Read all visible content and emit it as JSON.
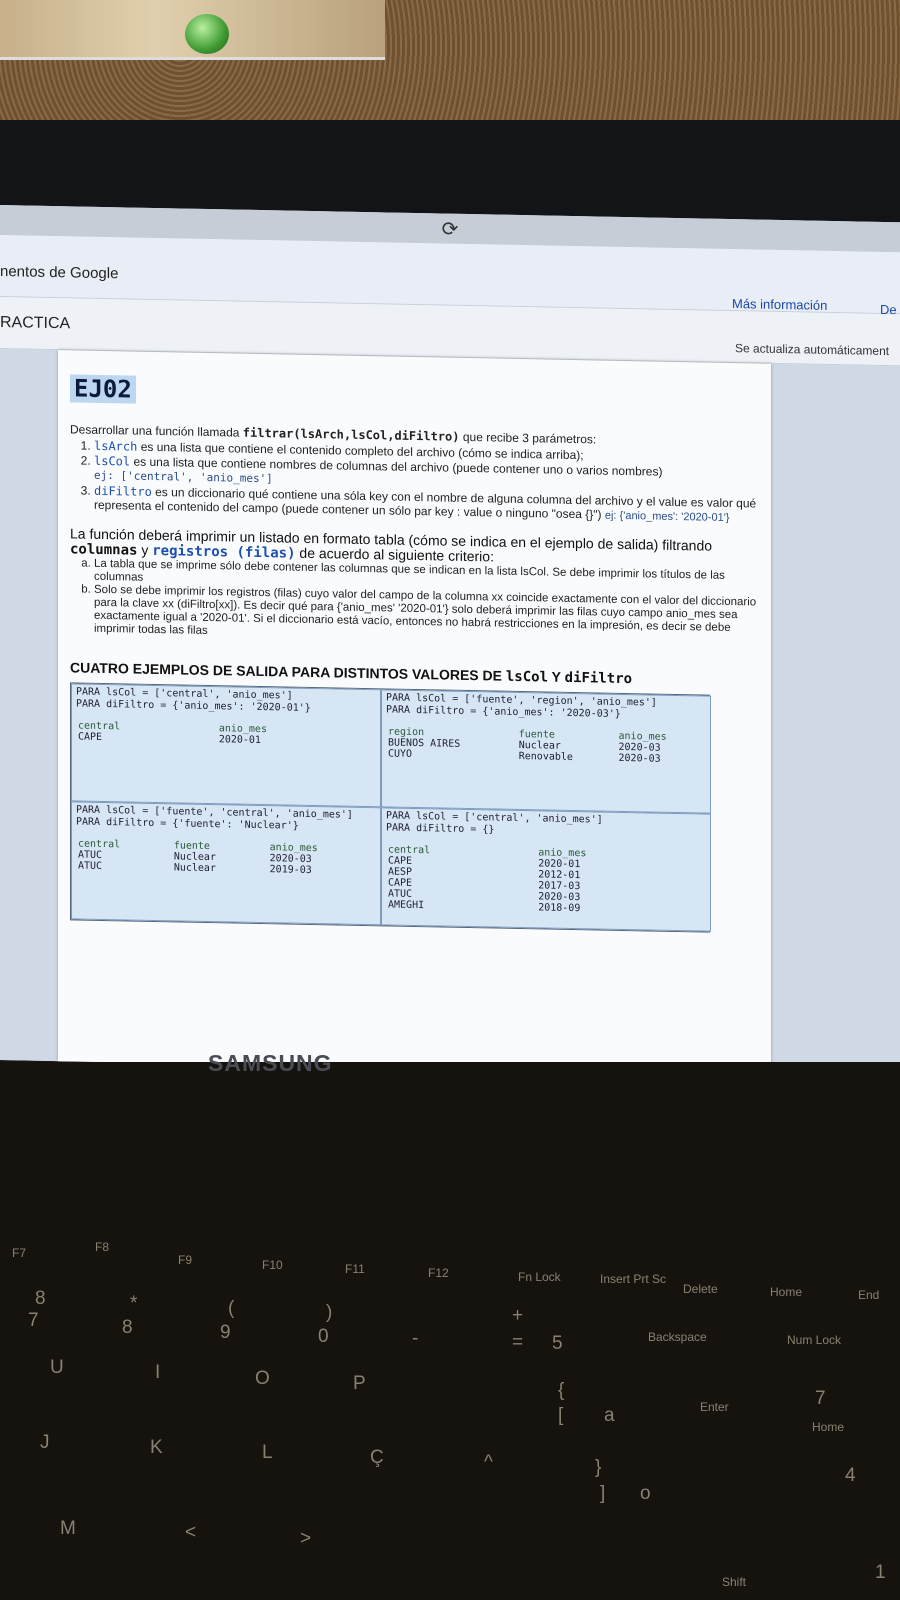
{
  "browser": {
    "refresh_icon": "refresh-icon"
  },
  "notice": {
    "brand": "nentos de Google",
    "more_info": "Más información",
    "truncated": "De"
  },
  "doc": {
    "title": "RACTICA",
    "auto_update": "Se actualiza automáticament"
  },
  "heading": "EJ02",
  "intro": {
    "prefix": "Desarrollar una función llamada ",
    "signature": "filtrar(lsArch,lsCol,diFiltro)",
    "suffix": " que recibe 3 parámetros:"
  },
  "params": [
    {
      "name": "lsArch",
      "text": " es una lista que contiene el contenido completo del archivo (cómo se indica arriba);"
    },
    {
      "name": "lsCol",
      "text": " es una lista que contiene nombres de columnas del archivo (puede contener uno o varios nombres)",
      "example": "ej: ['central', 'anio_mes']"
    },
    {
      "name": "diFiltro",
      "text": " es un diccionario qué contiene una sóla key con el nombre de alguna columna del archivo y el value es valor qué representa el contenido del campo (puede contener un sólo par key : value o ninguno \"osea {}\")",
      "example": "ej: {'anio_mes': '2020-01'}"
    }
  ],
  "desc": {
    "line1": "La función deberá imprimir un listado en formato tabla (cómo se indica en el ejemplo de salida) filtrando ",
    "columnas": "columnas",
    "y": " y ",
    "registros": "registros (filas)",
    "rest": " de acuerdo al siguiente criterio:"
  },
  "criteria": [
    "La tabla que se imprime sólo debe contener las columnas que se indican en la lista lsCol. Se debe imprimir los títulos de las columnas",
    "Solo se debe imprimir los registros (filas) cuyo valor del campo de la columna xx coincide exactamente con el valor del diccionario para la clave xx (diFiltro[xx]). Es decir qué para {'anio_mes' '2020-01'} solo deberá imprimir las filas cuyo campo anio_mes sea exactamente igual a '2020-01'. Si el diccionario está vacío, entonces no habrá restricciones en la impresión, es decir se debe imprimir todas las filas"
  ],
  "examples_title": {
    "text": "CUATRO EJEMPLOS DE SALIDA PARA DISTINTOS VALORES DE ",
    "lscol": "lsCol",
    "y": " Y ",
    "difiltro": "diFiltro"
  },
  "examples": [
    {
      "lscol": "PARA lsCol = ['central', 'anio_mes']",
      "difiltro": "PARA diFiltro = {'anio_mes': '2020-01'}",
      "headers": [
        "central",
        "anio_mes"
      ],
      "rows": [
        [
          "CAPE",
          "2020-01"
        ]
      ]
    },
    {
      "lscol": "PARA lsCol = ['fuente', 'region', 'anio_mes']",
      "difiltro": "PARA diFiltro = {'anio_mes': '2020-03'}",
      "headers": [
        "region",
        "fuente",
        "anio_mes"
      ],
      "rows": [
        [
          "BUENOS AIRES",
          "Nuclear",
          "2020-03"
        ],
        [
          "CUYO",
          "Renovable",
          "2020-03"
        ]
      ]
    },
    {
      "lscol": "PARA lsCol = ['fuente', 'central', 'anio_mes']",
      "difiltro": "PARA diFiltro = {'fuente': 'Nuclear'}",
      "headers": [
        "central",
        "fuente",
        "anio_mes"
      ],
      "rows": [
        [
          "ATUC",
          "Nuclear",
          "2020-03"
        ],
        [
          "ATUC",
          "Nuclear",
          "2019-03"
        ]
      ]
    },
    {
      "lscol": "PARA lsCol = ['central', 'anio_mes']",
      "difiltro": "PARA diFiltro = {}",
      "headers": [
        "central",
        "anio_mes"
      ],
      "rows": [
        [
          "CAPE",
          "2020-01"
        ],
        [
          "AESP",
          "2012-01"
        ],
        [
          "CAPE",
          "2017-03"
        ],
        [
          "ATUC",
          "2020-03"
        ],
        [
          "AMEGHI",
          "2018-09"
        ]
      ]
    }
  ],
  "laptop": {
    "brand": "SAMSUNG"
  },
  "keys": [
    "F7",
    "F8",
    "F9",
    "F10",
    "F11",
    "F12",
    "Fn Lock",
    "Insert Prt Sc",
    "Delete",
    "Home",
    "End",
    "Backspace",
    "Num Lock",
    "Enter",
    "Home",
    "Shift"
  ],
  "keyglyphs": [
    "8",
    "7",
    "*",
    "8",
    "(",
    "9",
    ")",
    "0",
    "-",
    "+",
    "=",
    "5",
    "U",
    "I",
    "O",
    "P",
    "{",
    "[",
    "a",
    "7",
    "J",
    "K",
    "L",
    "Ç",
    "^",
    "}",
    "]",
    "o",
    "4",
    "M",
    "<",
    ">",
    "1"
  ]
}
